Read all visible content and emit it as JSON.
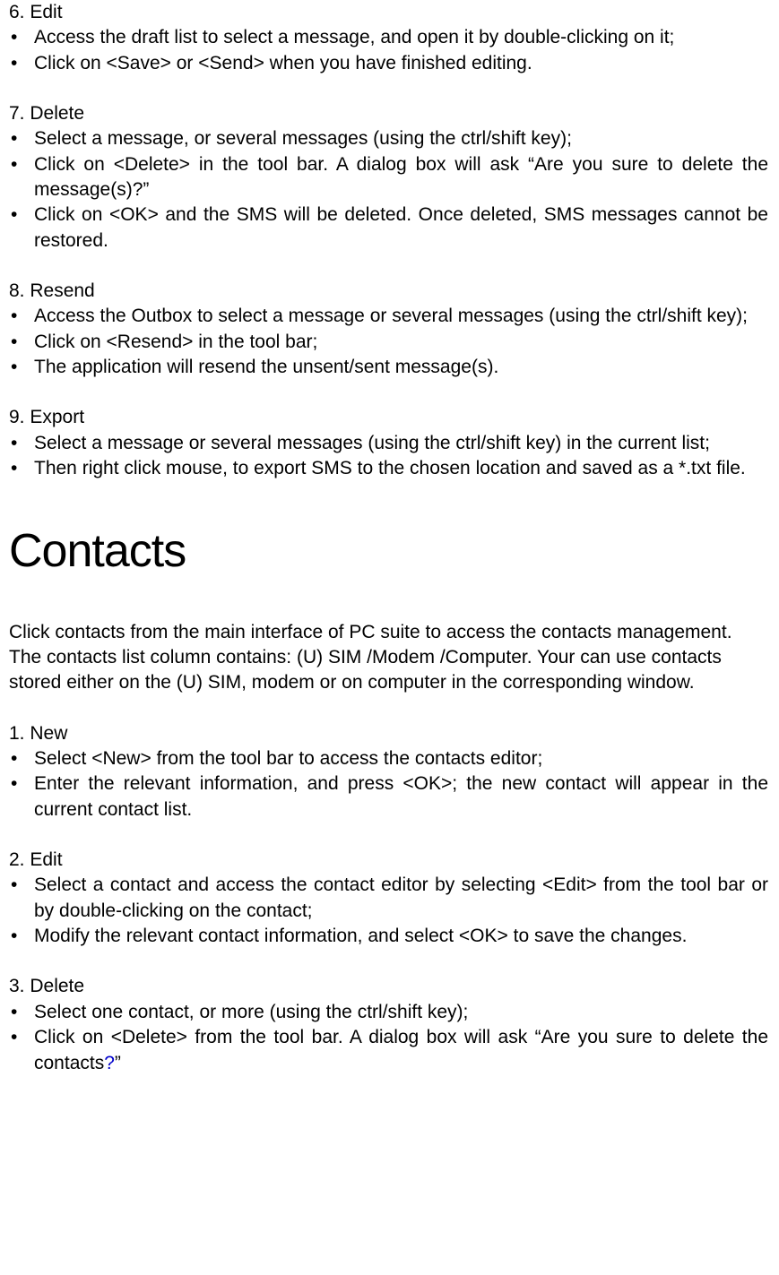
{
  "sections": {
    "s6": {
      "title": "6. Edit",
      "items": [
        "Access the draft list to select a message, and open it by double-clicking on it;",
        "Click on <Save> or <Send> when you have finished editing."
      ]
    },
    "s7": {
      "title": "7. Delete",
      "items": [
        "Select a message, or several messages (using the ctrl/shift key);",
        "Click on <Delete> in the tool bar. A dialog box will ask “Are you sure to delete the message(s)?”",
        "Click on <OK> and the SMS will be deleted. Once deleted, SMS messages cannot be restored."
      ]
    },
    "s8": {
      "title": "8. Resend",
      "items": [
        "Access the Outbox to select a message or several messages (using the ctrl/shift key);",
        "Click on <Resend> in the tool bar;",
        "The application will resend the unsent/sent message(s)."
      ]
    },
    "s9": {
      "title": "9. Export",
      "items": [
        "Select a message or several messages (using the ctrl/shift key) in the current list;",
        "Then right click mouse, to export SMS to the chosen location and saved as a *.txt file."
      ]
    }
  },
  "heading": "Contacts",
  "intro1": "Click contacts from the main interface of PC suite to access the contacts management.",
  "intro2": "The contacts list column contains: (U) SIM /Modem /Computer. Your can use contacts stored either on the (U) SIM, modem or on computer in the corresponding window.",
  "csections": {
    "c1": {
      "title": "1. New",
      "items": [
        "Select <New> from the tool bar to access the contacts editor;",
        "Enter the relevant information, and press <OK>; the new contact will appear in the current contact list."
      ]
    },
    "c2": {
      "title": "2. Edit",
      "items": [
        "Select a contact and access the contact editor by selecting <Edit> from the tool bar or by double-clicking on the contact;",
        "Modify the relevant contact information, and select <OK> to save the changes."
      ]
    },
    "c3": {
      "title": "3. Delete",
      "items": [
        "Select one contact, or more (using the ctrl/shift key);"
      ],
      "last_prefix": "Click on <Delete> from the tool bar. A dialog box will ask “Are you sure to delete the contacts",
      "last_q": "?",
      "last_suffix": "”"
    }
  },
  "bullet": "•"
}
